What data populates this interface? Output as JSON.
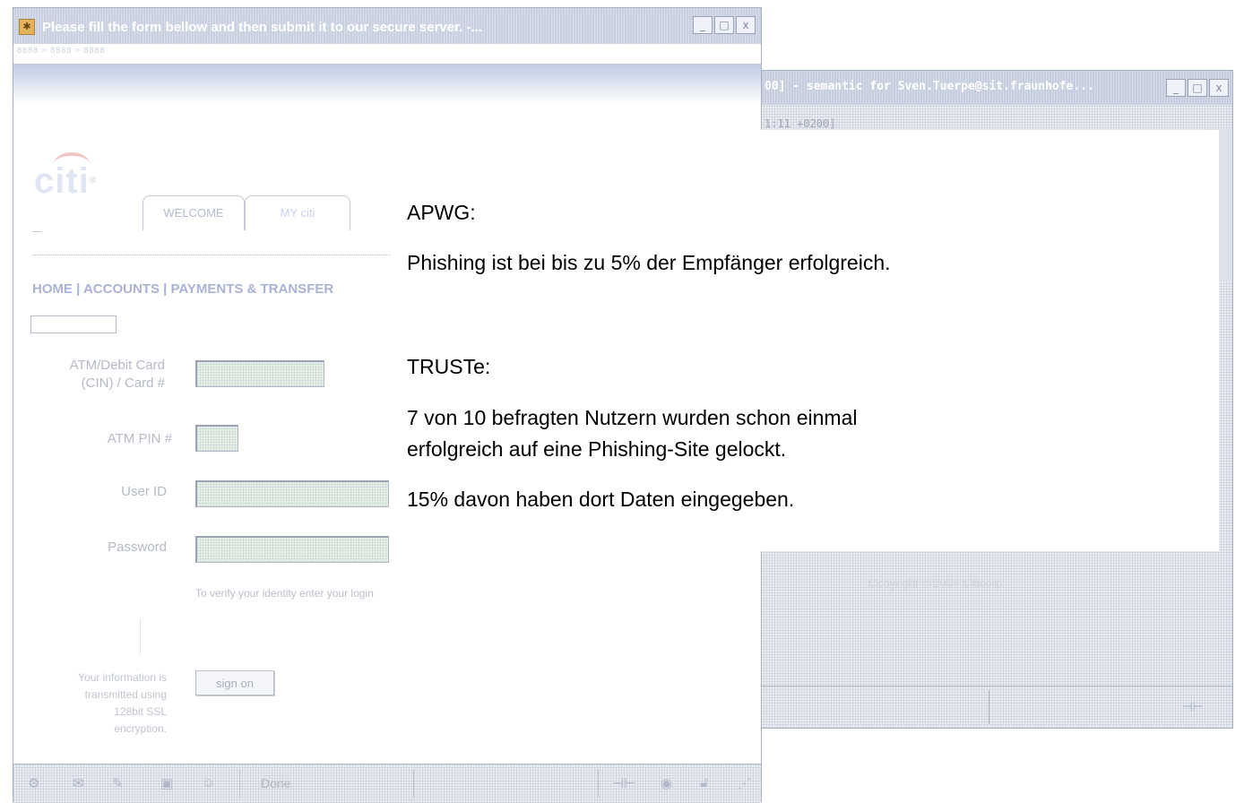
{
  "back_window": {
    "title": "00] - semantic for Sven.Tuerpe@sit.fraunhofe...",
    "timestamp": "1:11 +0200]",
    "controls": {
      "minimize": "_",
      "maximize": "□",
      "close": "x"
    },
    "copyright": "Copyright © 2004 Citicorp"
  },
  "front_window": {
    "title": "Please fill the form bellow and then submit it to our secure server.  -...",
    "subbar": "8888 > 8888 > 8888",
    "controls": {
      "minimize": "_",
      "maximize": "□",
      "close": "x"
    },
    "logo_text": "citi",
    "tabs": {
      "welcome": "WELCOME",
      "my_citi": "MY citi"
    },
    "nav": "HOME | ACCOUNTS | PAYMENTS & TRANSFER",
    "form": {
      "card_label": "ATM/Debit Card (CIN) / Card #",
      "card_label_line1": "ATM/Debit Card",
      "card_label_line2": "(CIN) / Card #",
      "pin_label": "ATM PIN #",
      "userid_label": "User ID",
      "password_label": "Password",
      "hint": "To verify your identity enter your login",
      "ssl_note": [
        "Your information is",
        "transmitted using",
        "128bit SSL",
        "encryption."
      ],
      "signon_button": "sign on"
    },
    "status_text": "Done"
  },
  "overlay": {
    "apwg_heading": "APWG:",
    "apwg_text": "Phishing ist bei bis zu 5% der Empfänger erfolgreich.",
    "truste_heading": "TRUSTe:",
    "truste_line1": "7 von 10 befragten Nutzern wurden schon einmal",
    "truste_line2": "erfolgreich auf eine Phishing-Site gelockt.",
    "truste_line3": "15% davon haben dort Daten eingegeben."
  }
}
